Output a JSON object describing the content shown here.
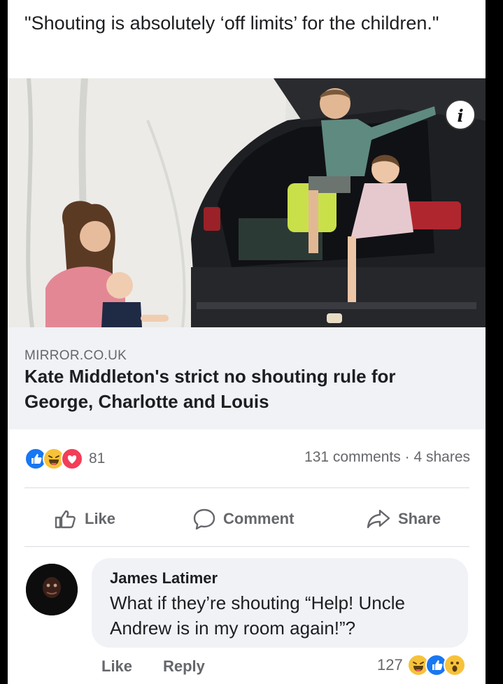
{
  "post": {
    "caption": "\"Shouting is absolutely ‘off limits’ for the children.\""
  },
  "link": {
    "domain": "MIRROR.CO.UK",
    "title": "Kate Middleton's strict no shouting rule for George, Charlotte and Louis",
    "info_glyph": "i"
  },
  "stats": {
    "reactions": [
      "like-reaction-icon",
      "haha-reaction-icon",
      "love-reaction-icon"
    ],
    "reaction_count": "81",
    "engagement": "131 comments · 4 shares"
  },
  "actions": {
    "like": "Like",
    "comment": "Comment",
    "share": "Share"
  },
  "comment": {
    "author": "James Latimer",
    "text": "What if they’re shouting “Help! Uncle Andrew is in my room again!”?",
    "like": "Like",
    "reply": "Reply",
    "reaction_count": "127",
    "reactions": [
      "haha-reaction-icon",
      "like-reaction-icon",
      "wow-reaction-icon"
    ]
  },
  "colors": {
    "like_blue": "#1877f2",
    "haha_yellow": "#f7c23a",
    "love_red": "#f33e58",
    "secondary_text": "#65676b",
    "link_box_bg": "#f0f2f5"
  }
}
